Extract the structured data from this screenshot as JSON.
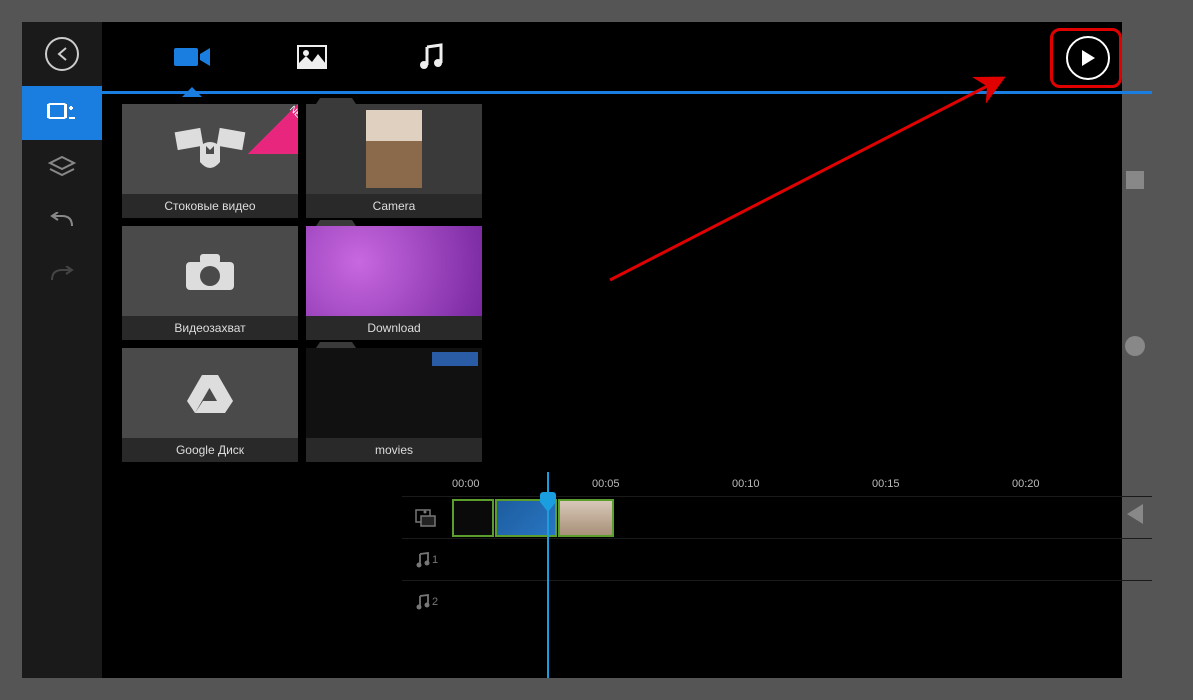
{
  "topTabs": {
    "video": "video",
    "image": "image",
    "music": "music"
  },
  "folders": {
    "stock": {
      "label": "Стоковые видео",
      "badge": "NEW"
    },
    "camera": {
      "label": "Camera"
    },
    "capture": {
      "label": "Видеозахват"
    },
    "download": {
      "label": "Download"
    },
    "gdrive": {
      "label": "Google Диск"
    },
    "movies": {
      "label": "movies"
    }
  },
  "timeline": {
    "ticks": [
      "00:00",
      "00:05",
      "00:10",
      "00:15",
      "00:20"
    ],
    "audioTrack1": "1",
    "audioTrack2": "2"
  }
}
